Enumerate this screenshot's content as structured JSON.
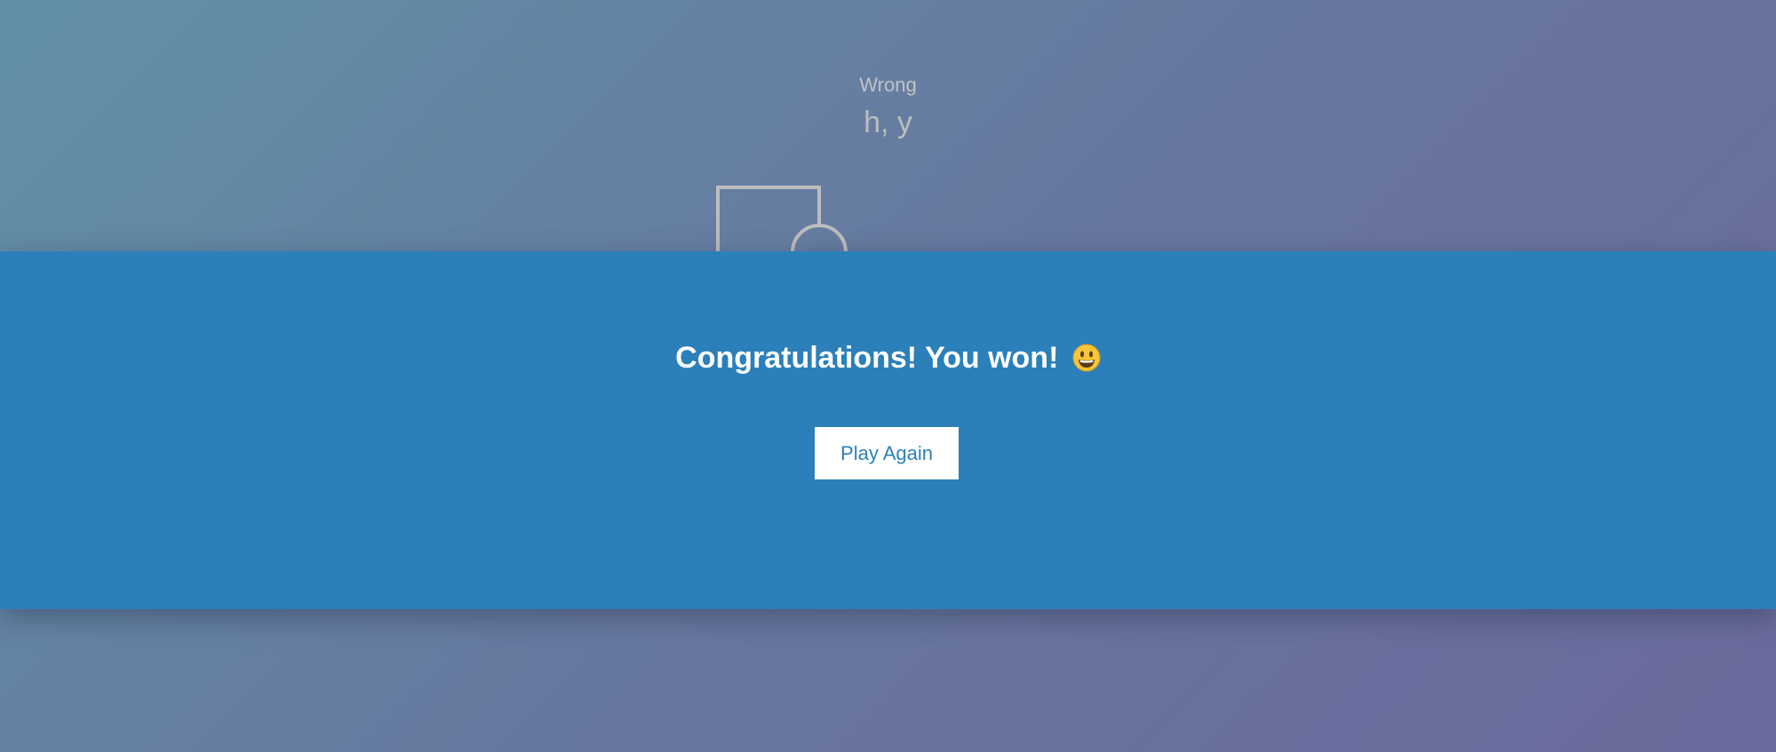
{
  "game": {
    "wrong_label": "Wrong",
    "wrong_letters": "h, y"
  },
  "popup": {
    "message": "Congratulations! You won!",
    "emoji_icon": "grinning-face-icon",
    "play_again_label": "Play Again"
  },
  "colors": {
    "band": "#2b80b9",
    "button_text": "#2b80b9",
    "figure_stroke": "#bdbdbd"
  }
}
